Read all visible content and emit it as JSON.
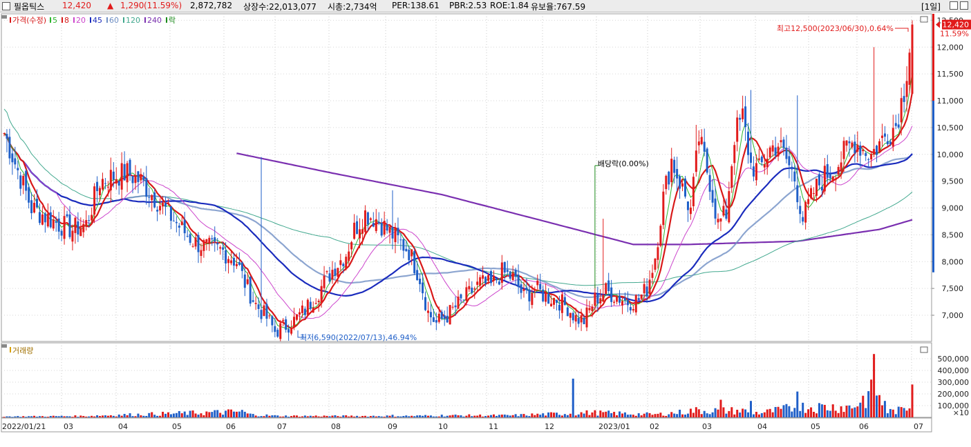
{
  "header": {
    "stock_name": "필옵틱스",
    "price": "12,420",
    "change_arrow": "▲",
    "change": "1,290",
    "change_pct": "(11.59%)",
    "volume": "2,872,782",
    "listed_shares": "상장수:22,013,077",
    "market_cap": "시총:2,734억",
    "per": "PER:138.61",
    "pbr": "PBR:2.53",
    "roe": "ROE:1.84",
    "reserve_ratio": "유보율:767.59",
    "period": "[1일]"
  },
  "colors": {
    "up": "#e11b1b",
    "down": "#1f5fc8",
    "ma5": "#2db52d",
    "ma8": "#d81818",
    "ma20": "#cc44cc",
    "ma45": "#1a2bbd",
    "ma60": "#6f8fc4",
    "ma120": "#41a88e",
    "ma240": "#7a2fb0",
    "ex_dividend": "#1a8a1a"
  },
  "chart_data": [
    {
      "type": "candlestick",
      "legend": [
        {
          "label": "가격(수정)",
          "color": "#d81818"
        },
        {
          "label": "5",
          "color": "#2db52d"
        },
        {
          "label": "8",
          "color": "#d81818"
        },
        {
          "label": "20",
          "color": "#cc44cc"
        },
        {
          "label": "45",
          "color": "#1a2bbd"
        },
        {
          "label": "60",
          "color": "#6f8fc4"
        },
        {
          "label": "120",
          "color": "#41a88e"
        },
        {
          "label": "240",
          "color": "#7a2fb0"
        },
        {
          "label": "락",
          "color": "#1a8a1a"
        }
      ],
      "y_ticks": [
        "12,500",
        "12,000",
        "11,500",
        "11,000",
        "10,500",
        "10,000",
        "9,500",
        "9,000",
        "8,500",
        "8,000",
        "7,500",
        "7,000"
      ],
      "y_tick_values": [
        12500,
        12000,
        11500,
        11000,
        10500,
        10000,
        9500,
        9000,
        8500,
        8000,
        7500,
        7000
      ],
      "ylim": [
        6400,
        12900
      ],
      "last_price_label": "12,420",
      "last_pct_label": "11.59%",
      "annotations": {
        "high": "최고12,500(2023/06/30),0.64%",
        "low": "최저6,590(2022/07/13),46.94%",
        "ex_dividend": "배당락(0.00%)"
      },
      "anchors": [
        [
          0,
          10400
        ],
        [
          5,
          9700
        ],
        [
          10,
          9000
        ],
        [
          15,
          8850
        ],
        [
          20,
          8700
        ],
        [
          25,
          8600
        ],
        [
          30,
          8700
        ],
        [
          35,
          9500
        ],
        [
          40,
          9600
        ],
        [
          45,
          9650
        ],
        [
          50,
          9500
        ],
        [
          55,
          9200
        ],
        [
          60,
          8900
        ],
        [
          65,
          8600
        ],
        [
          70,
          8350
        ],
        [
          75,
          8250
        ],
        [
          80,
          8200
        ],
        [
          85,
          8000
        ],
        [
          88,
          7600
        ],
        [
          92,
          7200
        ],
        [
          96,
          6950
        ],
        [
          99,
          6700
        ],
        [
          102,
          6780
        ],
        [
          106,
          6900
        ],
        [
          110,
          7100
        ],
        [
          115,
          7450
        ],
        [
          120,
          7850
        ],
        [
          125,
          8150
        ],
        [
          128,
          8600
        ],
        [
          132,
          8900
        ],
        [
          136,
          8800
        ],
        [
          140,
          8600
        ],
        [
          144,
          8400
        ],
        [
          148,
          8200
        ],
        [
          152,
          7700
        ],
        [
          155,
          7050
        ],
        [
          158,
          6850
        ],
        [
          162,
          7000
        ],
        [
          166,
          7200
        ],
        [
          170,
          7400
        ],
        [
          174,
          7600
        ],
        [
          178,
          7550
        ],
        [
          182,
          7800
        ],
        [
          186,
          7700
        ],
        [
          190,
          7350
        ],
        [
          194,
          7500
        ],
        [
          198,
          7350
        ],
        [
          202,
          7300
        ],
        [
          206,
          7150
        ],
        [
          209,
          6950
        ],
        [
          212,
          6900
        ],
        [
          216,
          7300
        ],
        [
          220,
          7450
        ],
        [
          224,
          7350
        ],
        [
          228,
          7250
        ],
        [
          232,
          7300
        ],
        [
          235,
          7500
        ],
        [
          238,
          8100
        ],
        [
          241,
          9200
        ],
        [
          244,
          9900
        ],
        [
          248,
          9350
        ],
        [
          251,
          8950
        ],
        [
          254,
          10300
        ],
        [
          258,
          9500
        ],
        [
          261,
          8700
        ],
        [
          264,
          8900
        ],
        [
          267,
          10350
        ],
        [
          270,
          10700
        ],
        [
          273,
          9800
        ],
        [
          276,
          9700
        ],
        [
          280,
          10100
        ],
        [
          283,
          10200
        ],
        [
          286,
          9900
        ],
        [
          289,
          9550
        ],
        [
          292,
          8800
        ],
        [
          296,
          9300
        ],
        [
          300,
          9600
        ],
        [
          304,
          9750
        ],
        [
          308,
          10100
        ],
        [
          311,
          10250
        ],
        [
          314,
          10100
        ],
        [
          317,
          10000
        ],
        [
          320,
          10200
        ],
        [
          323,
          10400
        ],
        [
          326,
          10550
        ],
        [
          329,
          11200
        ],
        [
          332,
          12420
        ]
      ],
      "volume_anchors": [
        [
          0,
          18
        ],
        [
          30,
          28
        ],
        [
          35,
          40
        ],
        [
          87,
          120
        ],
        [
          90,
          60
        ],
        [
          100,
          30
        ],
        [
          126,
          28
        ],
        [
          150,
          30
        ],
        [
          160,
          40
        ],
        [
          185,
          40
        ],
        [
          215,
          100
        ],
        [
          238,
          60
        ],
        [
          248,
          110
        ],
        [
          252,
          145
        ],
        [
          270,
          140
        ],
        [
          276,
          90
        ],
        [
          283,
          150
        ],
        [
          290,
          220
        ],
        [
          310,
          220
        ],
        [
          318,
          540
        ],
        [
          323,
          120
        ],
        [
          328,
          150
        ],
        [
          332,
          280
        ]
      ],
      "volume_spikes": [
        [
          208,
          330
        ],
        [
          142,
          22
        ],
        [
          318,
          540
        ],
        [
          332,
          280
        ],
        [
          290,
          220
        ],
        [
          262,
          150
        ],
        [
          273,
          140
        ],
        [
          322,
          140
        ]
      ]
    },
    {
      "type": "bar",
      "legend": [
        {
          "label": "거래량",
          "color": "#d8a000"
        }
      ],
      "y_ticks": [
        "500,000",
        "400,000",
        "300,000",
        "200,000",
        "100,000"
      ],
      "y_tick_values": [
        500,
        400,
        300,
        200,
        100
      ],
      "unit_label": "×10",
      "x_tick_labels": [
        "2022/01/21",
        "03",
        "04",
        "05",
        "06",
        "07",
        "08",
        "09",
        "10",
        "11",
        "12",
        "2023/01",
        "02",
        "03",
        "04",
        "05",
        "06",
        "07"
      ]
    }
  ]
}
